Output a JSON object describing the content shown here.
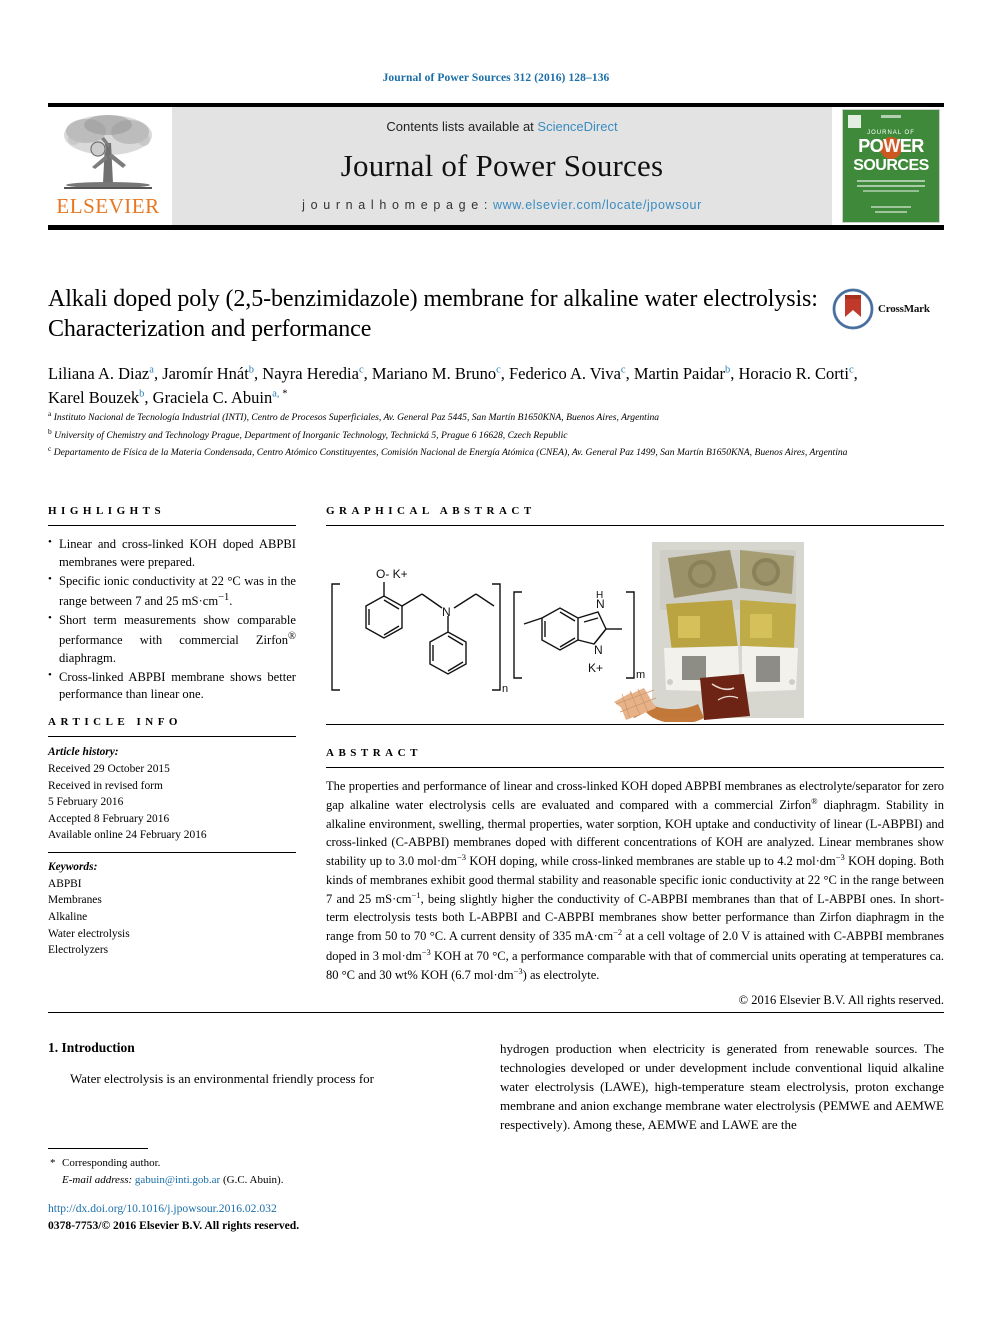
{
  "running_head": "Journal of Power Sources 312 (2016) 128–136",
  "masthead": {
    "contents_prefix": "Contents lists available at ",
    "sciencedirect": "ScienceDirect",
    "journal_title": "Journal of Power Sources",
    "homepage_prefix": "j o u r n a l   h o m e p a g e :  ",
    "homepage_url": "www.elsevier.com/locate/jpowsour",
    "publisher_wordmark": "ELSEVIER",
    "cover_alt": "Journal of Power Sources cover",
    "cover_line1": "JOURNAL OF",
    "cover_line2": "POWER",
    "cover_line3": "SOURCES"
  },
  "article": {
    "title": "Alkali doped poly (2,5-benzimidazole) membrane for alkaline water electrolysis: Characterization and performance",
    "crossmark_label": "CrossMark",
    "authors": [
      {
        "name": "Liliana A. Diaz",
        "sup": "a",
        "sep": ", "
      },
      {
        "name": "Jaromír Hnát",
        "sup": "b",
        "sep": ", "
      },
      {
        "name": "Nayra Heredia",
        "sup": "c",
        "sep": ", "
      },
      {
        "name": "Mariano M. Bruno",
        "sup": "c",
        "sep": ", "
      },
      {
        "name": "Federico A. Viva",
        "sup": "c",
        "sep": ", "
      },
      {
        "name": "Martin Paidar",
        "sup": "b",
        "sep": ", "
      },
      {
        "name": "Horacio R. Corti",
        "sup": "c",
        "sep": ", "
      },
      {
        "name": "Karel Bouzek",
        "sup": "b",
        "sep": ", "
      },
      {
        "name": "Graciela C. Abuin",
        "sup": "a, *",
        "sep": ""
      }
    ],
    "affiliations": [
      {
        "marker": "a",
        "text": "Instituto Nacional de Tecnología Industrial (INTI), Centro de Procesos Superficiales, Av. General Paz 5445, San Martín B1650KNA, Buenos Aires, Argentina"
      },
      {
        "marker": "b",
        "text": "University of Chemistry and Technology Prague, Department of Inorganic Technology, Technická 5, Prague 6 16628, Czech Republic"
      },
      {
        "marker": "c",
        "text": "Departamento de Física de la Materia Condensada, Centro Atómico Constituyentes, Comisión Nacional de Energía Atómica (CNEA), Av. General Paz 1499, San Martín B1650KNA, Buenos Aires, Argentina"
      }
    ]
  },
  "highlights": {
    "heading": "HIGHLIGHTS",
    "items": [
      "Linear and cross-linked KOH doped ABPBI membranes were prepared.",
      "Specific ionic conductivity at 22 °C was in the range between 7 and 25 mS·cm−1.",
      "Short term measurements show comparable performance with commercial Zirfon® diaphragm.",
      "Cross-linked ABPBI membrane shows better performance than linear one."
    ]
  },
  "graphical_abstract": {
    "heading": "GRAPHICAL ABSTRACT",
    "figure_labels": {
      "ok": "O- K+",
      "n_nitrogen": "N",
      "h_label": "H",
      "n_label": "N",
      "k_plus": "K+",
      "sub_n": "n",
      "sub_m": "m"
    }
  },
  "article_info": {
    "heading": "ARTICLE INFO",
    "history_label": "Article history:",
    "history": [
      "Received 29 October 2015",
      "Received in revised form",
      "5 February 2016",
      "Accepted 8 February 2016",
      "Available online 24 February 2016"
    ],
    "keywords_label": "Keywords:",
    "keywords": [
      "ABPBI",
      "Membranes",
      "Alkaline",
      "Water electrolysis",
      "Electrolyzers"
    ]
  },
  "abstract": {
    "heading": "ABSTRACT",
    "paragraphs": [
      "The properties and performance of linear and cross-linked KOH doped ABPBI membranes as electrolyte/separator for zero gap alkaline water electrolysis cells are evaluated and compared with a commercial Zirfon® diaphragm. Stability in alkaline environment, swelling, thermal properties, water sorption, KOH uptake and conductivity of linear (L-ABPBI) and cross-linked (C-ABPBI) membranes doped with different concentrations of KOH are analyzed. Linear membranes show stability up to 3.0 mol·dm−3 KOH doping, while cross-linked membranes are stable up to 4.2 mol·dm−3 KOH doping. Both kinds of membranes exhibit good thermal stability and reasonable specific ionic conductivity at 22 °C in the range between 7 and 25 mS·cm−1, being slightly higher the conductivity of C-ABPBI membranes than that of L-ABPBI ones. In short-term electrolysis tests both L-ABPBI and C-ABPBI membranes show better performance than Zirfon diaphragm in the range from 50 to 70 °C. A current density of 335 mA·cm−2 at a cell voltage of 2.0 V is attained with C-ABPBI membranes doped in 3 mol·dm−3 KOH at 70 °C, a performance comparable with that of commercial units operating at temperatures ca. 80 °C and 30 wt% KOH (6.7 mol·dm−3) as electrolyte."
    ],
    "copyright": "© 2016 Elsevier B.V. All rights reserved."
  },
  "body": {
    "section_number_title": "1. Introduction",
    "left_paragraph": "Water electrolysis is an environmental friendly process for",
    "right_paragraph": "hydrogen production when electricity is generated from renewable sources. The technologies developed or under development include conventional liquid alkaline water electrolysis (LAWE), high-temperature steam electrolysis, proton exchange membrane and anion exchange membrane water electrolysis (PEMWE and AEMWE respectively). Among these, AEMWE and LAWE are the"
  },
  "footnote": {
    "star": "*",
    "corresponding": "Corresponding author.",
    "email_label": "E-mail address:",
    "email": "gabuin@inti.gob.ar",
    "email_owner": "(G.C. Abuin)."
  },
  "footer": {
    "doi": "http://dx.doi.org/10.1016/j.jpowsour.2016.02.032",
    "issn_line": "0378-7753/© 2016 Elsevier B.V. All rights reserved."
  },
  "colors": {
    "link_blue": "#1a6ea8",
    "sciencedirect_blue": "#3a8cc1",
    "elsevier_orange": "#E87722",
    "cover_green": "#3f8a3a",
    "sup_blue": "#2b7fb8"
  }
}
